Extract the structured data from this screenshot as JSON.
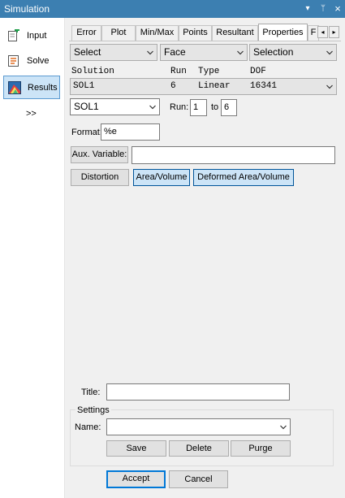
{
  "window": {
    "title": "Simulation",
    "ctrl_dropdown": "▾",
    "ctrl_pin": "ᛘ",
    "ctrl_close": "×"
  },
  "sidebar": {
    "items": [
      {
        "label": "Input",
        "icon": "input-icon"
      },
      {
        "label": "Solve",
        "icon": "solve-icon"
      },
      {
        "label": "Results",
        "icon": "results-icon"
      }
    ],
    "more": ">>"
  },
  "tabs": {
    "items": [
      "Error",
      "Plot",
      "Min/Max",
      "Points",
      "Resultant",
      "Properties",
      "F"
    ],
    "active": "Properties",
    "scroll_left": "◂",
    "scroll_right": "▸"
  },
  "filters": {
    "select": "Select",
    "face": "Face",
    "selection": "Selection"
  },
  "solution_table": {
    "headers": {
      "solution": "Solution",
      "run": "Run",
      "type": "Type",
      "dof": "DOF"
    },
    "row": {
      "solution": "SOL1",
      "run": "6",
      "type": "Linear",
      "dof": "16341"
    }
  },
  "run_controls": {
    "solution": "SOL1",
    "run_label": "Run:",
    "run_from": "1",
    "to_label": "to",
    "run_to": "6"
  },
  "format": {
    "label": "Format:",
    "value": "%e"
  },
  "aux": {
    "button": "Aux. Variable:",
    "value": ""
  },
  "options": {
    "distortion": "Distortion",
    "area_volume": "Area/Volume",
    "deformed_area_volume": "Deformed Area/Volume"
  },
  "title_field": {
    "label": "Title:",
    "value": ""
  },
  "settings": {
    "legend": "Settings",
    "name_label": "Name:",
    "name_value": "",
    "save": "Save",
    "delete": "Delete",
    "purge": "Purge"
  },
  "footer": {
    "accept": "Accept",
    "cancel": "Cancel"
  },
  "colors": {
    "titlebar": "#3c7fb1",
    "selected_bg": "#cce4f7",
    "selected_border": "#0078d7"
  }
}
